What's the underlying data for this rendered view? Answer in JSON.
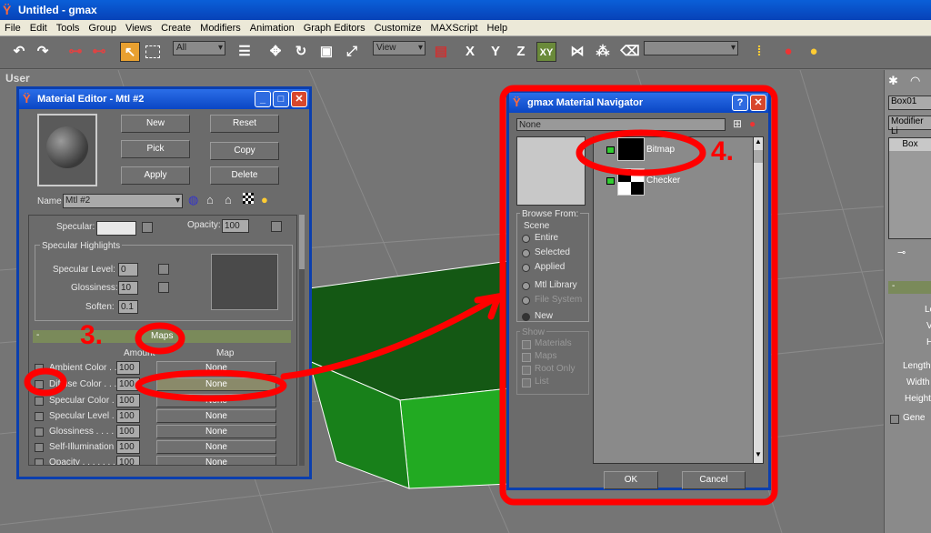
{
  "app": {
    "title": "Untitled - gmax"
  },
  "menu": [
    "File",
    "Edit",
    "Tools",
    "Group",
    "Views",
    "Create",
    "Modifiers",
    "Animation",
    "Graph Editors",
    "Customize",
    "MAXScript",
    "Help"
  ],
  "toolbar": {
    "selection_filter": "All",
    "ref_coord": "View",
    "axis_x": "X",
    "axis_y": "Y",
    "axis_z": "Z",
    "axis_xy": "XY"
  },
  "viewport": {
    "label": "User"
  },
  "right_panel": {
    "object_name": "Box01",
    "modifier_list": "Modifier Li",
    "stack_item": "Box",
    "rollout_minus": "-",
    "labels": [
      "Le",
      "V",
      "H",
      "Length",
      "Width",
      "Height"
    ],
    "gen_label": "Gene"
  },
  "mat_editor": {
    "title": "Material Editor - Mtl #2",
    "buttons": {
      "new": "New",
      "reset": "Reset",
      "pick": "Pick",
      "copy": "Copy",
      "apply": "Apply",
      "delete": "Delete"
    },
    "name_label": "Name",
    "name_value": "Mtl #2",
    "specular_label": "Specular:",
    "opacity_label": "Opacity:",
    "opacity_value": "100",
    "spec_highlights_title": "Specular Highlights",
    "spec_level_label": "Specular Level:",
    "spec_level_value": "0",
    "glossiness_label": "Glossiness:",
    "glossiness_value": "10",
    "soften_label": "Soften:",
    "soften_value": "0.1",
    "maps_minus": "-",
    "maps_title": "Maps",
    "amount_header": "Amount",
    "map_header": "Map",
    "map_rows": [
      {
        "label": "Ambient Color . .",
        "amount": "100",
        "map": "None"
      },
      {
        "label": "Diffuse Color . . .",
        "amount": "100",
        "map": "None"
      },
      {
        "label": "Specular Color . .",
        "amount": "100",
        "map": "None"
      },
      {
        "label": "Specular Level . .",
        "amount": "100",
        "map": "None"
      },
      {
        "label": "Glossiness . . . . .",
        "amount": "100",
        "map": "None"
      },
      {
        "label": "Self-Illumination .",
        "amount": "100",
        "map": "None"
      },
      {
        "label": "Opacity . . . . . . .",
        "amount": "100",
        "map": "None"
      }
    ]
  },
  "navigator": {
    "title": "gmax Material Navigator",
    "search_value": "None",
    "browse_from_title": "Browse From:",
    "scene_title": "Scene",
    "browse_options": [
      "Entire",
      "Selected",
      "Applied",
      "Mtl Library",
      "File System",
      "New"
    ],
    "show_title": "Show",
    "show_options": [
      "Materials",
      "Maps",
      "Root Only",
      "List"
    ],
    "items": [
      "Bitmap",
      "Checker"
    ],
    "ok_label": "OK",
    "cancel_label": "Cancel"
  },
  "annotations": {
    "step3": "3.",
    "step4": "4."
  }
}
